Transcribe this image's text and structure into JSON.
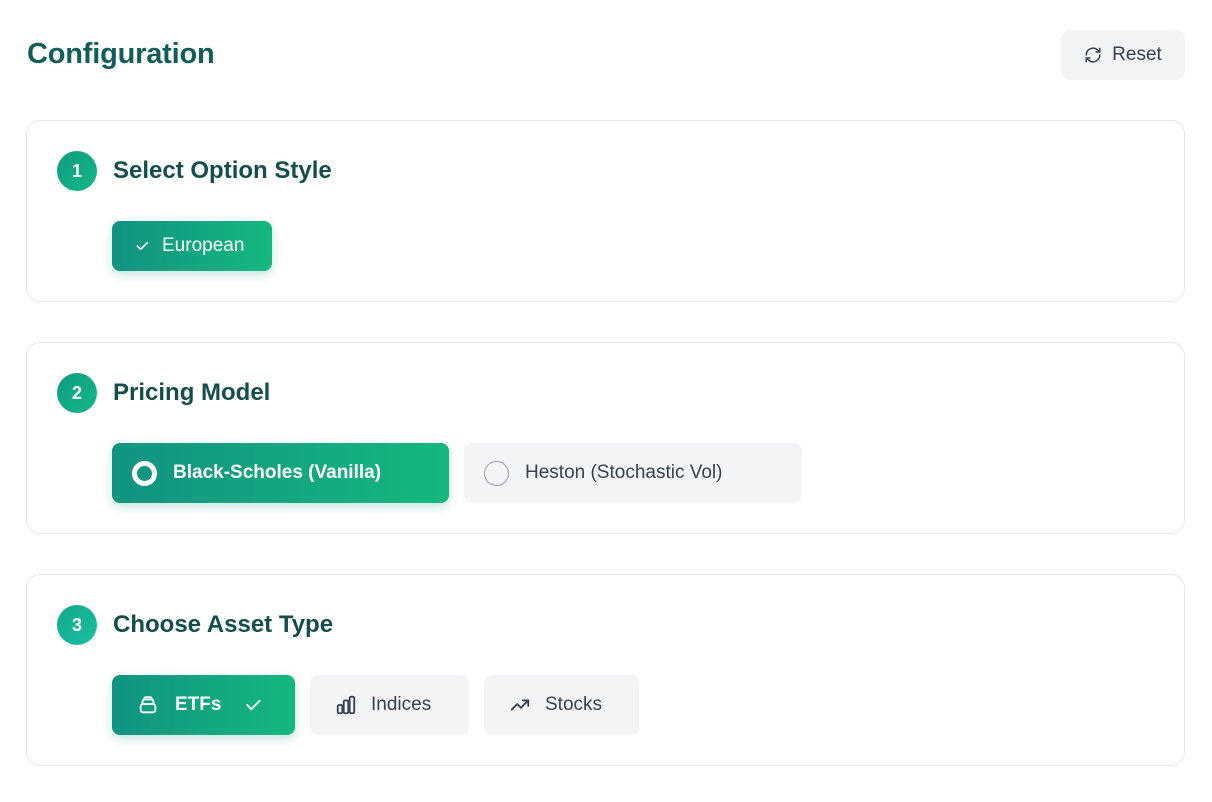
{
  "header": {
    "title": "Configuration",
    "reset_label": "Reset",
    "reset_icon": "refresh-icon"
  },
  "steps": [
    {
      "number": "1",
      "title": "Select Option Style",
      "options": [
        {
          "label": "European",
          "selected": true,
          "icon": "check-icon"
        }
      ]
    },
    {
      "number": "2",
      "title": "Pricing Model",
      "options": [
        {
          "label": "Black-Scholes (Vanilla)",
          "selected": true,
          "icon": "radio-selected-icon"
        },
        {
          "label": "Heston (Stochastic Vol)",
          "selected": false,
          "icon": "radio-unselected-icon"
        }
      ]
    },
    {
      "number": "3",
      "title": "Choose Asset Type",
      "options": [
        {
          "label": "ETFs",
          "selected": true,
          "icon": "stack-icon"
        },
        {
          "label": "Indices",
          "selected": false,
          "icon": "bar-chart-icon"
        },
        {
          "label": "Stocks",
          "selected": false,
          "icon": "trending-up-icon"
        }
      ]
    }
  ],
  "colors": {
    "accent_start": "#119381",
    "accent_end": "#14b87f",
    "title": "#115e59",
    "unselected_bg": "#f3f4f6"
  }
}
